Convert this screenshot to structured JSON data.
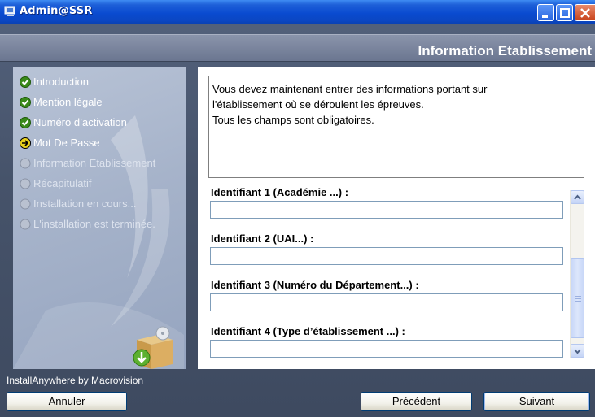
{
  "window": {
    "title": "Admin@SSR",
    "header": "Information Etablissement"
  },
  "steps": [
    {
      "label": "Introduction",
      "status": "done"
    },
    {
      "label": "Mention légale",
      "status": "done"
    },
    {
      "label": "Numéro d’activation",
      "status": "done"
    },
    {
      "label": "Mot De Passe",
      "status": "current"
    },
    {
      "label": "Information Etablissement",
      "status": "pending"
    },
    {
      "label": "Récapitulatif",
      "status": "pending"
    },
    {
      "label": "Installation en cours...",
      "status": "pending"
    },
    {
      "label": "L'installation est terminée.",
      "status": "pending"
    }
  ],
  "description": {
    "line1": "Vous devez maintenant entrer des informations portant sur",
    "line2": "l'établissement où se déroulent les épreuves.",
    "line3": "Tous les champs sont obligatoires."
  },
  "fields": [
    {
      "label": "Identifiant 1 (Académie ...) :",
      "value": ""
    },
    {
      "label": "Identifiant 2 (UAI...) :",
      "value": ""
    },
    {
      "label": "Identifiant 3 (Numéro du Département...) :",
      "value": ""
    },
    {
      "label": "Identifiant 4 (Type d’établissement ...) :",
      "value": ""
    }
  ],
  "footer": {
    "brand": "InstallAnywhere by Macrovision",
    "cancel_label": "Annuler",
    "prev_label": "Précédent",
    "next_label": "Suivant"
  },
  "icons": {
    "done": "check-circle-icon",
    "current": "arrow-circle-icon",
    "pending": "empty-circle-icon"
  },
  "colors": {
    "titlebar": "#0a4bd0",
    "done_icon": "#3a8a1a",
    "current_icon": "#e8d01c",
    "pending_icon": "#a0a8b8"
  }
}
